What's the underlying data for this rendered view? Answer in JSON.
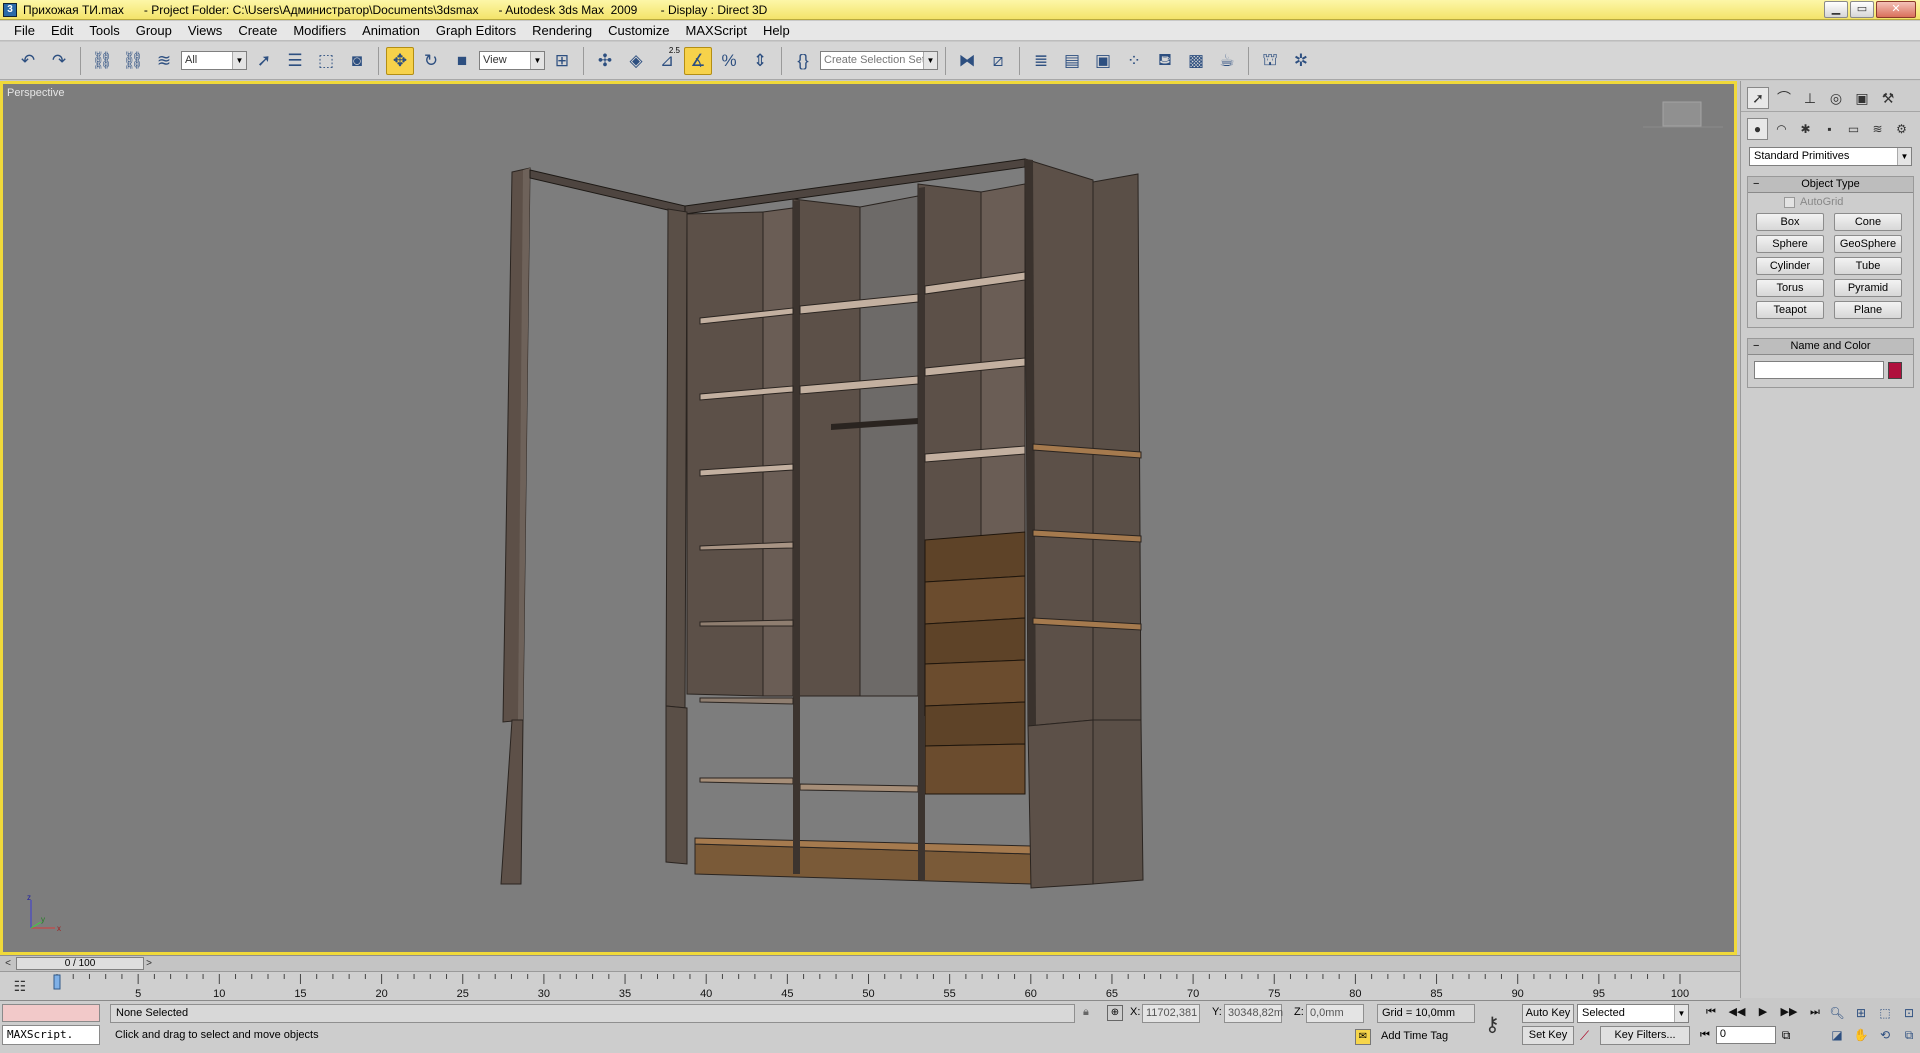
{
  "window": {
    "icon": "3ds-max-icon",
    "title": "Прихожая ТИ.max      - Project Folder: C:\\Users\\Администратор\\Documents\\3dsmax      - Autodesk 3ds Max  2009       - Display : Direct 3D",
    "controls": [
      "minimize-icon",
      "maximize-icon",
      "close-icon"
    ]
  },
  "menu": [
    "File",
    "Edit",
    "Tools",
    "Group",
    "Views",
    "Create",
    "Modifiers",
    "Animation",
    "Graph Editors",
    "Rendering",
    "Customize",
    "MAXScript",
    "Help"
  ],
  "toolbar": {
    "selection_filter": "All",
    "reference_coord": "View",
    "angle_snap_label": "2.5",
    "named_selection_placeholder": "Create Selection Set",
    "active_color": "#f7d24a"
  },
  "viewport": {
    "label": "Perspective",
    "background": "#7d7d7d",
    "border_color": "#f0d93a",
    "axis_labels": {
      "x": "x",
      "y": "y",
      "z": "z"
    }
  },
  "command_panel": {
    "category": "Standard Primitives",
    "object_type_title": "Object Type",
    "autogrid_label": "AutoGrid",
    "primitives": [
      "Box",
      "Cone",
      "Sphere",
      "GeoSphere",
      "Cylinder",
      "Tube",
      "Torus",
      "Pyramid",
      "Teapot",
      "Plane"
    ],
    "name_color_title": "Name and Color",
    "object_color": "#b0103d"
  },
  "time_slider": {
    "position_label": "0 / 100",
    "prev": "<",
    "next": ">"
  },
  "track_bar": {
    "ticks": [
      "0",
      "5",
      "10",
      "15",
      "20",
      "25",
      "30",
      "35",
      "40",
      "45",
      "50",
      "55",
      "60",
      "65",
      "70",
      "75",
      "80",
      "85",
      "90",
      "95",
      "100"
    ]
  },
  "status": {
    "maxscript_prompt": "MAXScript.",
    "selection": "None Selected",
    "prompt": "Click and drag to select and move objects",
    "x_label": "X:",
    "x_value": "11702,381",
    "y_label": "Y:",
    "y_value": "30348,82m",
    "z_label": "Z:",
    "z_value": "0,0mm",
    "grid": "Grid = 10,0mm",
    "add_time_tag": "Add Time Tag",
    "auto_key": "Auto Key",
    "set_key": "Set Key",
    "key_mode": "Selected",
    "key_filters": "Key Filters...",
    "current_frame": "0"
  }
}
